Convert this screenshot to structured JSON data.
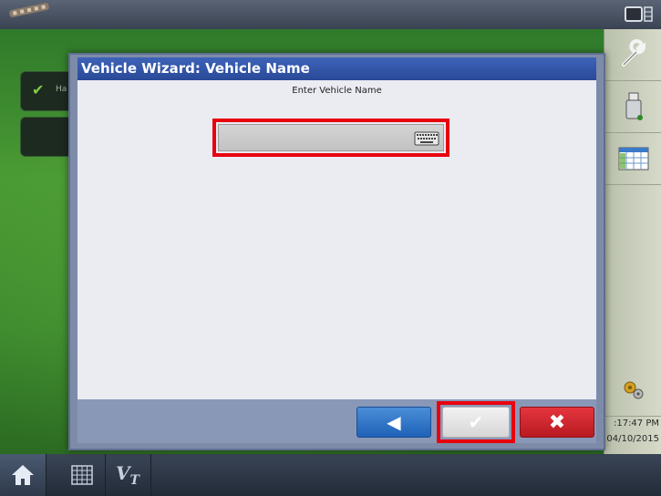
{
  "window": {
    "title": "Vehicle Wizard:  Vehicle Name",
    "prompt": "Enter Vehicle Name"
  },
  "vehicle_name_input": {
    "value": "",
    "placeholder": ""
  },
  "background": {
    "card_label": "Ha"
  },
  "buttons": {
    "back_glyph": "◀",
    "ok_glyph": "✔",
    "cancel_glyph": "✖"
  },
  "status": {
    "time": ":17:47 PM",
    "date": "04/10/2015"
  },
  "bottom_nav": {
    "vt_label": "V",
    "vt_sub": "T"
  },
  "colors": {
    "title_bar": "#2f55a8",
    "back_button": "#2f74c8",
    "cancel_button": "#d02a32",
    "highlight_box": "#e8000e",
    "map_green": "#3d8a2e"
  },
  "icons": [
    "gps-icon",
    "display-icon",
    "wrench-icon",
    "usb-drive-icon",
    "calendar-icon",
    "settings-gears-icon",
    "home-icon",
    "grid-icon",
    "keyboard-icon"
  ]
}
